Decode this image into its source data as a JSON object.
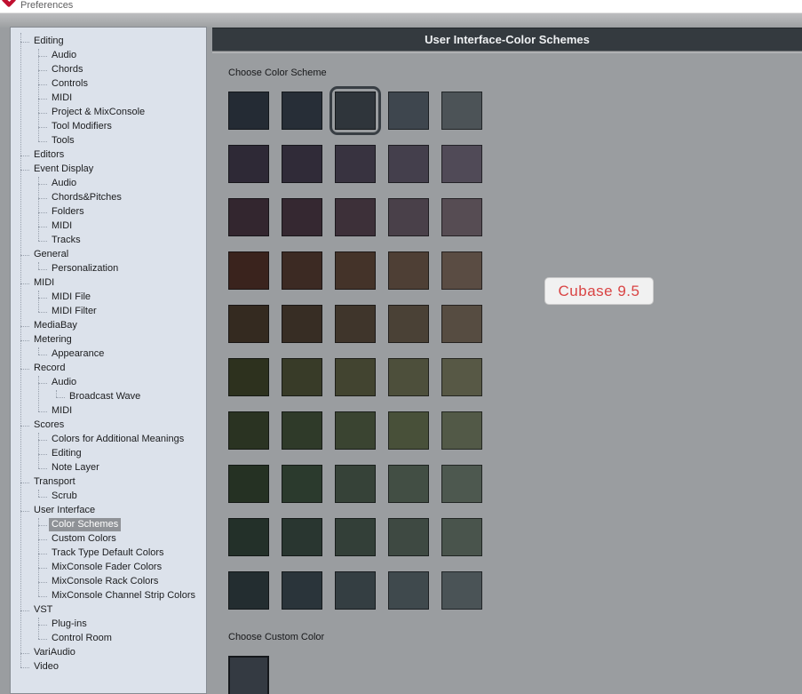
{
  "window": {
    "title": "Preferences"
  },
  "header": {
    "title": "User Interface-Color Schemes"
  },
  "sidebar": {
    "items": [
      {
        "label": "Editing",
        "level": 0,
        "selected": false
      },
      {
        "label": "Audio",
        "level": 1,
        "selected": false
      },
      {
        "label": "Chords",
        "level": 1,
        "selected": false
      },
      {
        "label": "Controls",
        "level": 1,
        "selected": false
      },
      {
        "label": "MIDI",
        "level": 1,
        "selected": false
      },
      {
        "label": "Project & MixConsole",
        "level": 1,
        "selected": false
      },
      {
        "label": "Tool Modifiers",
        "level": 1,
        "selected": false
      },
      {
        "label": "Tools",
        "level": 1,
        "selected": false
      },
      {
        "label": "Editors",
        "level": 0,
        "selected": false
      },
      {
        "label": "Event Display",
        "level": 0,
        "selected": false
      },
      {
        "label": "Audio",
        "level": 1,
        "selected": false
      },
      {
        "label": "Chords&Pitches",
        "level": 1,
        "selected": false
      },
      {
        "label": "Folders",
        "level": 1,
        "selected": false
      },
      {
        "label": "MIDI",
        "level": 1,
        "selected": false
      },
      {
        "label": "Tracks",
        "level": 1,
        "selected": false
      },
      {
        "label": "General",
        "level": 0,
        "selected": false
      },
      {
        "label": "Personalization",
        "level": 1,
        "selected": false
      },
      {
        "label": "MIDI",
        "level": 0,
        "selected": false
      },
      {
        "label": "MIDI File",
        "level": 1,
        "selected": false
      },
      {
        "label": "MIDI Filter",
        "level": 1,
        "selected": false
      },
      {
        "label": "MediaBay",
        "level": 0,
        "selected": false
      },
      {
        "label": "Metering",
        "level": 0,
        "selected": false
      },
      {
        "label": "Appearance",
        "level": 1,
        "selected": false
      },
      {
        "label": "Record",
        "level": 0,
        "selected": false
      },
      {
        "label": "Audio",
        "level": 1,
        "selected": false
      },
      {
        "label": "Broadcast Wave",
        "level": 2,
        "selected": false
      },
      {
        "label": "MIDI",
        "level": 1,
        "selected": false
      },
      {
        "label": "Scores",
        "level": 0,
        "selected": false
      },
      {
        "label": "Colors for Additional Meanings",
        "level": 1,
        "selected": false
      },
      {
        "label": "Editing",
        "level": 1,
        "selected": false
      },
      {
        "label": "Note Layer",
        "level": 1,
        "selected": false
      },
      {
        "label": "Transport",
        "level": 0,
        "selected": false
      },
      {
        "label": "Scrub",
        "level": 1,
        "selected": false
      },
      {
        "label": "User Interface",
        "level": 0,
        "selected": false
      },
      {
        "label": "Color Schemes",
        "level": 1,
        "selected": true
      },
      {
        "label": "Custom Colors",
        "level": 1,
        "selected": false
      },
      {
        "label": "Track Type Default Colors",
        "level": 1,
        "selected": false
      },
      {
        "label": "MixConsole Fader Colors",
        "level": 1,
        "selected": false
      },
      {
        "label": "MixConsole Rack Colors",
        "level": 1,
        "selected": false
      },
      {
        "label": "MixConsole Channel Strip Colors",
        "level": 1,
        "selected": false
      },
      {
        "label": "VST",
        "level": 0,
        "selected": false
      },
      {
        "label": "Plug-ins",
        "level": 1,
        "selected": false
      },
      {
        "label": "Control Room",
        "level": 1,
        "selected": false
      },
      {
        "label": "VariAudio",
        "level": 0,
        "selected": false
      },
      {
        "label": "Video",
        "level": 0,
        "selected": false
      }
    ]
  },
  "content": {
    "scheme_label": "Choose Color Scheme",
    "custom_label": "Choose Custom Color",
    "scheme_rows": [
      [
        "#242b34",
        "#272e37",
        "#2f353b",
        "#3e464e",
        "#4c5357"
      ],
      [
        "#2e2936",
        "#302b38",
        "#383340",
        "#443f4c",
        "#504a57"
      ],
      [
        "#33262f",
        "#352831",
        "#3d3039",
        "#494049",
        "#564c53"
      ],
      [
        "#3a231d",
        "#3c2a23",
        "#443329",
        "#4e3f35",
        "#5a4c43"
      ],
      [
        "#342a20",
        "#372d24",
        "#3f352b",
        "#4a4136",
        "#564c41"
      ],
      [
        "#2d311e",
        "#383b28",
        "#424430",
        "#4d4f3b",
        "#575845"
      ],
      [
        "#2a3322",
        "#2f3a29",
        "#3a4431",
        "#485039",
        "#525947"
      ],
      [
        "#253123",
        "#2b3a2d",
        "#364238",
        "#424e44",
        "#4d584f"
      ],
      [
        "#233029",
        "#293630",
        "#333f38",
        "#3e4942",
        "#49544c"
      ],
      [
        "#232d30",
        "#2a343a",
        "#343e42",
        "#3f494d",
        "#4a5356"
      ]
    ],
    "selected_swatch": {
      "row": 0,
      "col": 2
    },
    "custom_color": "#343a42",
    "overlay": {
      "text": "Cubase 9.5",
      "text_color": "#d94444"
    }
  },
  "theme_colors": {
    "header_bg": "#343a3f",
    "sidebar_bg": "#dce2eb",
    "content_bg": "#9a9da0",
    "tree_selection_bg": "#8f9297",
    "logo_red": "#c01030"
  }
}
